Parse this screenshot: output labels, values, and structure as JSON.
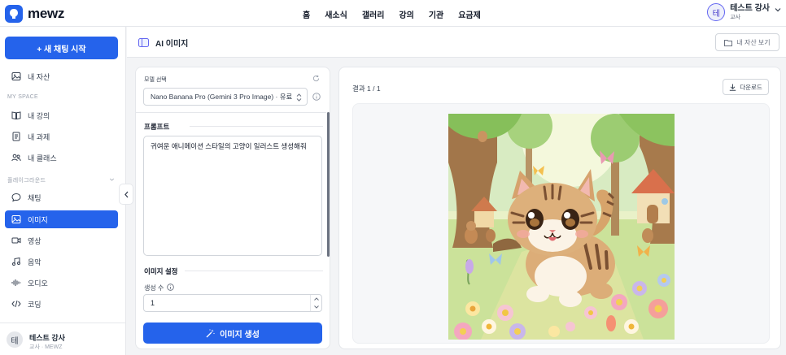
{
  "app": {
    "name": "mewz",
    "brand_color": "#2563eb"
  },
  "nav": {
    "items": [
      "홈",
      "새소식",
      "갤러리",
      "강의",
      "기관",
      "요금제"
    ]
  },
  "user": {
    "initial": "테",
    "name": "테스트 강사",
    "role": "교사"
  },
  "sidebar": {
    "new_chat": "+ 새 채팅 시작",
    "my_assets": "내 자산",
    "section_my_space": "MY SPACE",
    "my_space_items": [
      "내 강의",
      "내 과제",
      "내 클래스"
    ],
    "section_playground": "플레이그라운드",
    "playground_items": [
      "채팅",
      "이미지",
      "영상",
      "음악",
      "오디오",
      "코딩"
    ],
    "active": "이미지",
    "footer": {
      "initial": "테",
      "name": "테스트 강사",
      "role": "교사 · MEWZ"
    }
  },
  "page": {
    "title": "AI 이미지",
    "assets_button": "내 자산 보기"
  },
  "form": {
    "model_label": "모델 선택",
    "model_value": "Nano Banana Pro (Gemini 3 Pro Image) · 유료",
    "prompt_label": "프롬프트",
    "prompt_value": "귀여운 애니메이션 스타일의 고양이 일러스트 생성해줘",
    "settings_label": "이미지 설정",
    "count_label": "생성 수",
    "count_value": "1",
    "generate_button": "이미지 생성"
  },
  "result": {
    "count_text": "결과 1 / 1",
    "download_button": "다운로드"
  }
}
